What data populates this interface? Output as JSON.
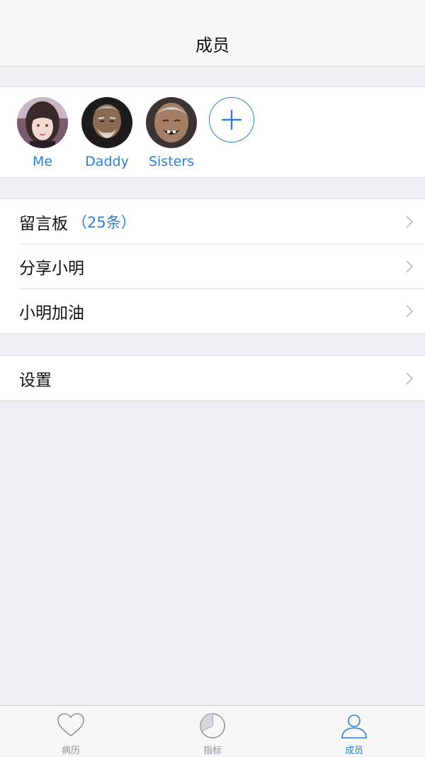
{
  "navbar": {
    "title": "成员"
  },
  "members": [
    {
      "name": "Me",
      "avatar_icon": "avatar-girl"
    },
    {
      "name": "Daddy",
      "avatar_icon": "avatar-old-man"
    },
    {
      "name": "Sisters",
      "avatar_icon": "avatar-old-woman"
    }
  ],
  "add_member_icon": "plus-icon",
  "menu": {
    "message_board": {
      "label": "留言板",
      "count": "（25条）"
    },
    "share": {
      "label": "分享小明"
    },
    "cheer": {
      "label": "小明加油"
    }
  },
  "settings": {
    "label": "设置"
  },
  "tabbar": {
    "tabs": [
      {
        "label": "病历",
        "icon": "heart-icon"
      },
      {
        "label": "指标",
        "icon": "pie-chart-icon"
      },
      {
        "label": "成员",
        "icon": "person-icon",
        "active": true
      }
    ]
  },
  "colors": {
    "accent": "#2b7fd6",
    "background": "#efeff4",
    "inactive": "#8e8e93"
  }
}
